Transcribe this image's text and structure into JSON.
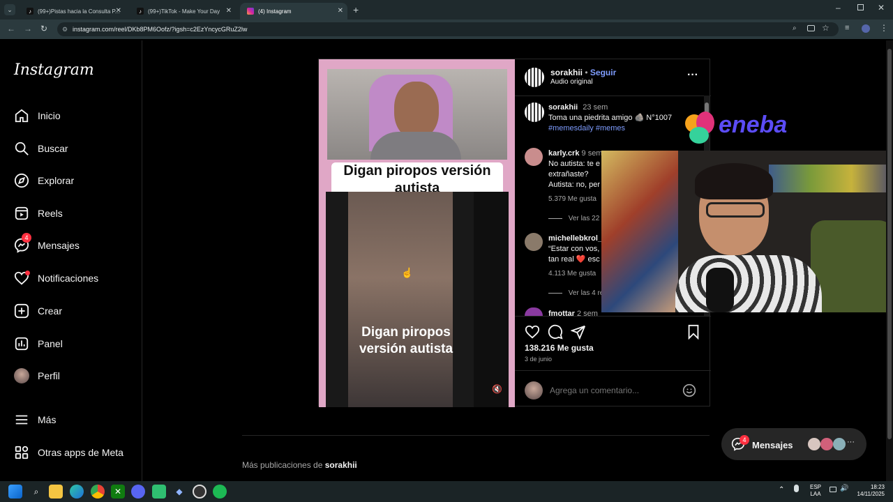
{
  "browser": {
    "tabs": [
      {
        "label": "(99+)Pistas hacia la Consulta P...",
        "icon": "tiktok-icon"
      },
      {
        "label": "(99+)TikTok - Make Your Day",
        "icon": "tiktok-icon"
      },
      {
        "label": "(4) Instagram",
        "icon": "instagram-icon"
      }
    ],
    "url": "instagram.com/reel/DKb8PM6Oofz/?igsh=c2EzYncycGRuZ2lw"
  },
  "sidebar": {
    "logo": "Instagram",
    "items": [
      {
        "label": "Inicio",
        "icon": "home-icon"
      },
      {
        "label": "Buscar",
        "icon": "search-icon"
      },
      {
        "label": "Explorar",
        "icon": "compass-icon"
      },
      {
        "label": "Reels",
        "icon": "reels-icon"
      },
      {
        "label": "Mensajes",
        "icon": "messenger-icon",
        "badge": "4"
      },
      {
        "label": "Notificaciones",
        "icon": "heart-icon"
      },
      {
        "label": "Crear",
        "icon": "plus-square-icon"
      },
      {
        "label": "Panel",
        "icon": "chart-icon"
      },
      {
        "label": "Perfil",
        "icon": "avatar-icon"
      }
    ],
    "more": "Más",
    "meta": "Otras apps de Meta"
  },
  "post": {
    "media_text_top": "Digan piropos versión autista",
    "media_text_bottom": "Digan piropos versión autista",
    "author": "sorakhii",
    "follow": "Seguir",
    "audio": "Audio original",
    "caption_author": "sorakhii",
    "caption_time": "23 sem",
    "caption_text": "Toma una piedrita amigo 🪨 N°1007",
    "caption_tags": "#memesdaily #memes",
    "comments": [
      {
        "user": "karly.crk",
        "time": "9 sem",
        "text": "No autista: te e extrañaste? Autista: no, per",
        "likes": "5.379 Me gusta",
        "replies": "Ver las 22 r"
      },
      {
        "user": "michellebkrol_",
        "time": "",
        "text": "“Estar con vos, tan real ❤️ esc",
        "likes": "4.113 Me gusta",
        "replies": "Ver las 4 re"
      },
      {
        "user": "fmottar",
        "time": "2 sem",
        "text": "",
        "likes": "",
        "replies": ""
      }
    ],
    "likes": "138.216 Me gusta",
    "date": "3 de junio",
    "comment_placeholder": "Agrega un comentario..."
  },
  "overlay": {
    "brand": "eneba"
  },
  "footer": {
    "more_prefix": "Más publicaciones de ",
    "more_user": "sorakhii",
    "messages_label": "Mensajes",
    "messages_badge": "4"
  },
  "taskbar": {
    "lang_top": "ESP",
    "lang_bottom": "LAA",
    "time": "18:23",
    "date": "14/11/2025"
  }
}
